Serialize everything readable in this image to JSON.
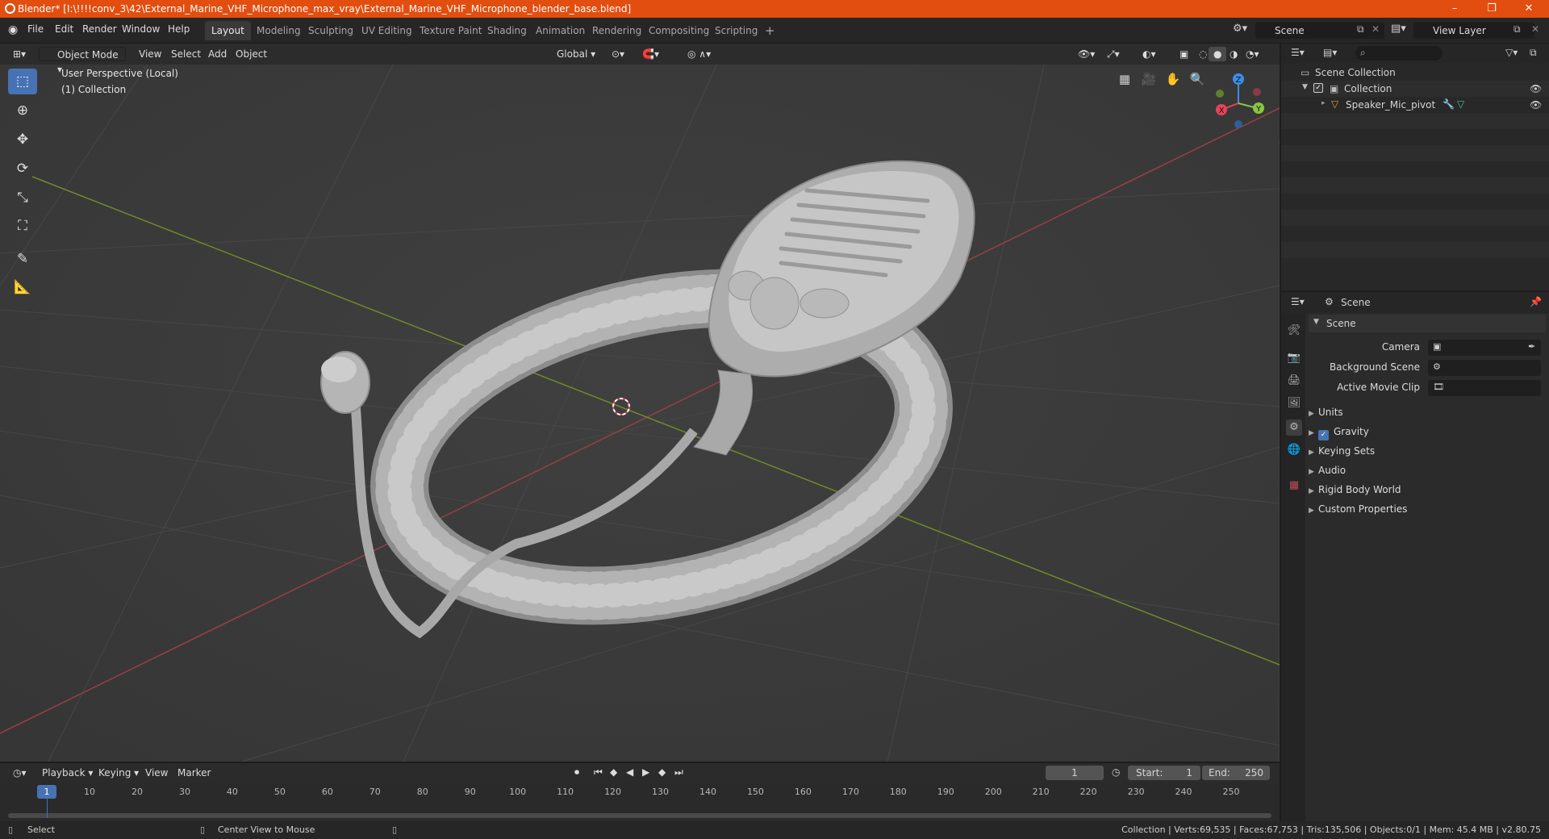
{
  "window": {
    "title": "Blender* [I:\\!!!!conv_3\\42\\External_Marine_VHF_Microphone_max_vray\\External_Marine_VHF_Microphone_blender_base.blend]",
    "minimize": "–",
    "restore": "❐",
    "close": "✕"
  },
  "menu": [
    "File",
    "Edit",
    "Render",
    "Window",
    "Help"
  ],
  "workspaces": [
    "Layout",
    "Modeling",
    "Sculpting",
    "UV Editing",
    "Texture Paint",
    "Shading",
    "Animation",
    "Rendering",
    "Compositing",
    "Scripting"
  ],
  "workspace_add": "+",
  "scene_field": "Scene",
  "view_layer_field": "View Layer",
  "viewport_header": {
    "mode": "Object Mode",
    "menus": [
      "View",
      "Select",
      "Add",
      "Object"
    ],
    "transform_orientation": "Global"
  },
  "viewport": {
    "perspective_label": "User Perspective (Local)",
    "collection_label": "(1) Collection",
    "gizmo_axes": {
      "x": "X",
      "y": "Y",
      "z": "Z"
    }
  },
  "tools": [
    "select-box-icon",
    "cursor-icon",
    "move-icon",
    "rotate-icon",
    "scale-icon",
    "transform-icon",
    "annotate-icon",
    "measure-icon"
  ],
  "outliner": {
    "search_placeholder": "",
    "root": "Scene Collection",
    "collection": "Collection",
    "object": "Speaker_Mic_pivot"
  },
  "properties": {
    "context": "Scene",
    "panel": "Scene",
    "camera_label": "Camera",
    "background_scene_label": "Background Scene",
    "active_movie_clip_label": "Active Movie Clip",
    "subpanels": [
      "Units",
      "Gravity",
      "Keying Sets",
      "Audio",
      "Rigid Body World",
      "Custom Properties"
    ],
    "gravity_checked": true
  },
  "timeline": {
    "menus": [
      "Playback",
      "Keying",
      "View",
      "Marker"
    ],
    "current_frame": "1",
    "start_label": "Start:",
    "start_value": "1",
    "end_label": "End:",
    "end_value": "250",
    "ticks": [
      "1",
      "10",
      "20",
      "30",
      "40",
      "50",
      "60",
      "70",
      "80",
      "90",
      "100",
      "110",
      "120",
      "130",
      "140",
      "150",
      "160",
      "170",
      "180",
      "190",
      "200",
      "210",
      "220",
      "230",
      "240",
      "250"
    ]
  },
  "status": {
    "left_action": "Select",
    "middle_action": "Center View to Mouse",
    "stats": "Collection | Verts:69,535 | Faces:67,753 | Tris:135,506 | Objects:0/1 | Mem: 45.4 MB | v2.80.75"
  },
  "colors": {
    "title_bar": "#e14e0f",
    "accent": "#4772b3",
    "axis_x": "#e8435a",
    "axis_y": "#8bc53f",
    "axis_z": "#3b8ee6",
    "frame_marker": "#4772b3"
  }
}
